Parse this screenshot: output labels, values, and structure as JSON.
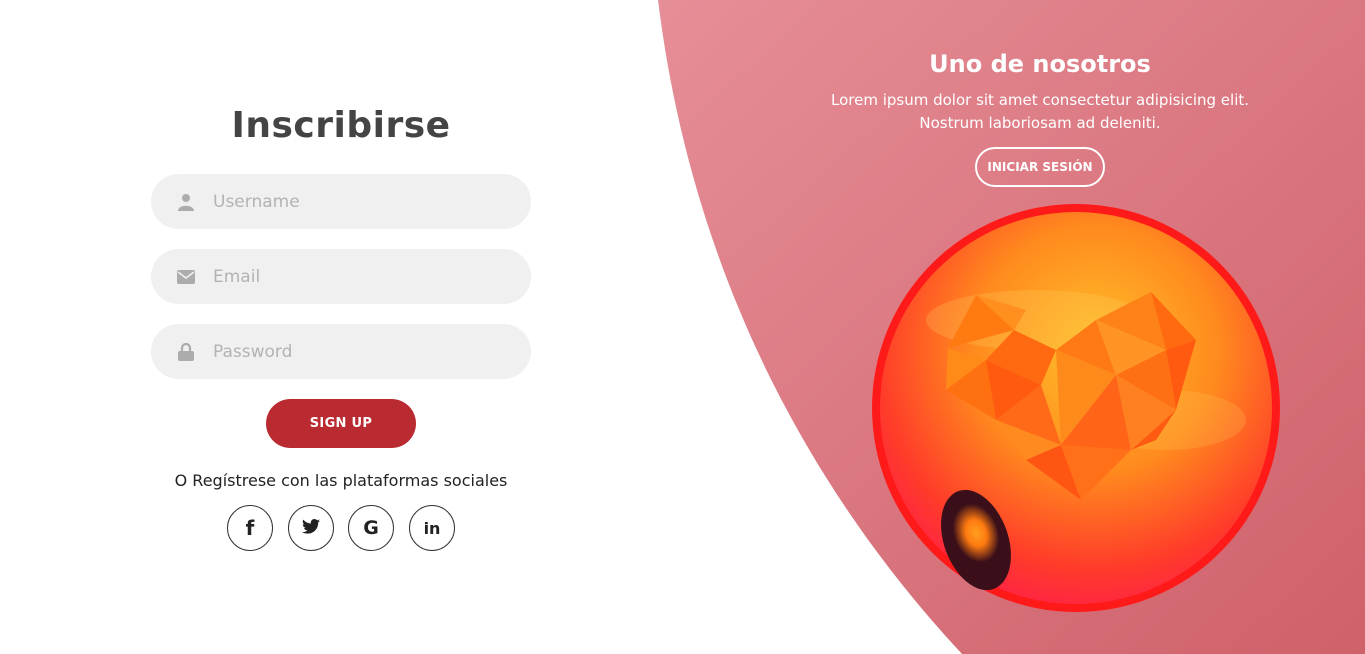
{
  "colors": {
    "accent": "#b92b30",
    "panel_start": "#e58a93",
    "panel_end": "#d0646c",
    "field_bg": "#f0f0f0"
  },
  "signup_form": {
    "title": "Inscribirse",
    "fields": [
      {
        "icon": "user-icon",
        "placeholder": "Username",
        "value": ""
      },
      {
        "icon": "envelope-icon",
        "placeholder": "Email",
        "value": ""
      },
      {
        "icon": "lock-icon",
        "placeholder": "Password",
        "value": ""
      }
    ],
    "submit_label": "SIGN UP",
    "social_text": "O Regístrese con las plataformas sociales",
    "social": [
      {
        "icon": "facebook-icon",
        "glyph": "f"
      },
      {
        "icon": "twitter-icon",
        "glyph": ""
      },
      {
        "icon": "google-icon",
        "glyph": "G"
      },
      {
        "icon": "linkedin-icon",
        "glyph": "in"
      }
    ]
  },
  "panel": {
    "title": "Uno de nosotros",
    "text_line1": "Lorem ipsum dolor sit amet consectetur adipisicing elit.",
    "text_line2": "Nostrum laboriosam ad deleniti.",
    "button_label": "INICIAR SESIÓN",
    "illustration": "heart-orb-illustration"
  }
}
